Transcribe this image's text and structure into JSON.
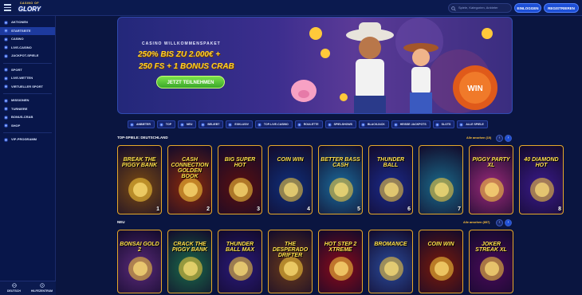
{
  "header": {
    "logo_small": "CASINO OF",
    "logo_big": "GLORY",
    "search_placeholder": "Spiele, Kategorien, Anbieter",
    "login_label": "EINLOGGEN",
    "register_label": "REGISTRIEREN"
  },
  "sidebar": {
    "items": [
      {
        "label": "AKTIONEN",
        "icon": "gift-icon",
        "active": false
      },
      {
        "label": "STARTSEITE",
        "icon": "home-icon",
        "active": true
      },
      {
        "label": "CASINO",
        "icon": "cherry-icon",
        "active": false
      },
      {
        "label": "LIVE-CASINO",
        "icon": "cards-icon",
        "active": false
      },
      {
        "label": "JACKPOT-SPIELE",
        "icon": "jackpot-icon",
        "active": false
      },
      {
        "label": "SPORT",
        "icon": "ball-icon",
        "active": false
      },
      {
        "label": "LIVE-WETTEN",
        "icon": "live-icon",
        "active": false
      },
      {
        "label": "VIRTUELLER SPORT",
        "icon": "gamepad-icon",
        "active": false
      },
      {
        "label": "MISSIONEN",
        "icon": "target-icon",
        "active": false
      },
      {
        "label": "TURNIERE",
        "icon": "trophy-icon",
        "active": false
      },
      {
        "label": "BONUS-CRAB",
        "icon": "crab-icon",
        "active": false
      },
      {
        "label": "SHOP",
        "icon": "shop-icon",
        "active": false
      },
      {
        "label": "VIP-PROGRAMM",
        "icon": "crown-icon",
        "active": false
      }
    ],
    "bottom": [
      {
        "label": "DEUTSCH",
        "icon": "language-icon"
      },
      {
        "label": "HILFEZENTRUM",
        "icon": "help-icon"
      }
    ]
  },
  "hero": {
    "kicker": "CASINO WILLKOMMENSPAKET",
    "line1": "250% BIS ZU 2.000€ +",
    "line2": "250 FS + 1 BONUS CRAB",
    "cta": "JETZT TEILNEHMEN"
  },
  "categories": [
    {
      "label": "ANBIETER",
      "icon": "provider-icon"
    },
    {
      "label": "TOP",
      "icon": "star-icon"
    },
    {
      "label": "NEU",
      "icon": "new-icon"
    },
    {
      "label": "BELIEBT",
      "icon": "heart-icon"
    },
    {
      "label": "EXKLUSIV",
      "icon": "diamond-icon"
    },
    {
      "label": "TOP-LIVE-CASINO",
      "icon": "live-casino-icon"
    },
    {
      "label": "ROULETTE",
      "icon": "roulette-icon"
    },
    {
      "label": "SPIELSHOWS",
      "icon": "tv-icon"
    },
    {
      "label": "BLACKJACK",
      "icon": "cards-icon"
    },
    {
      "label": "HEISSE JACKPOTS",
      "icon": "flame-icon"
    },
    {
      "label": "SLOTS",
      "icon": "slot-icon"
    },
    {
      "label": "ALLE SPIELE",
      "icon": "grid-icon"
    }
  ],
  "section_top": {
    "title": "TOP-SPIELE: DEUTSCHLAND",
    "see_all": "Alle ansehen (10)",
    "tiles": [
      {
        "name": "BREAK THE PIGGY BANK",
        "rank": "1",
        "bg": "#7a4a12"
      },
      {
        "name": "CASH CONNECTION GOLDEN BOOK",
        "rank": "2",
        "bg": "#8a2a0a"
      },
      {
        "name": "BIG SUPER HOT",
        "rank": "3",
        "bg": "#5a1010"
      },
      {
        "name": "COIN WIN",
        "rank": "4",
        "bg": "#0f2f7a"
      },
      {
        "name": "BETTER BASS CASH",
        "rank": "5",
        "bg": "#1a6a9a"
      },
      {
        "name": "THUNDER BALL",
        "rank": "6",
        "bg": "#1a2a8a"
      },
      {
        "name": "",
        "rank": "7",
        "bg": "#1a6a8a"
      },
      {
        "name": "PIGGY PARTY XL",
        "rank": "",
        "bg": "#9a2a7a"
      },
      {
        "name": "40 DIAMOND HOT",
        "rank": "8",
        "bg": "#3a1a8a"
      }
    ]
  },
  "section_new": {
    "title": "NEU",
    "see_all": "Alle ansehen (857)",
    "tiles": [
      {
        "name": "BONSAI GOLD 2",
        "bg": "#5a2a7a"
      },
      {
        "name": "CRACK THE PIGGY BANK",
        "bg": "#1a6a4a"
      },
      {
        "name": "THUNDER BALL MAX",
        "bg": "#2a1a7a"
      },
      {
        "name": "THE DESPERADO DRIFTER",
        "bg": "#6a3a1a"
      },
      {
        "name": "HOT STEP 2 XTREME",
        "bg": "#8a0a1a"
      },
      {
        "name": "BROMANCE",
        "bg": "#2a4a9a"
      },
      {
        "name": "COIN WIN",
        "bg": "#7a1a0a"
      },
      {
        "name": "JOKER STREAK XL",
        "bg": "#4a0a5a"
      }
    ]
  }
}
